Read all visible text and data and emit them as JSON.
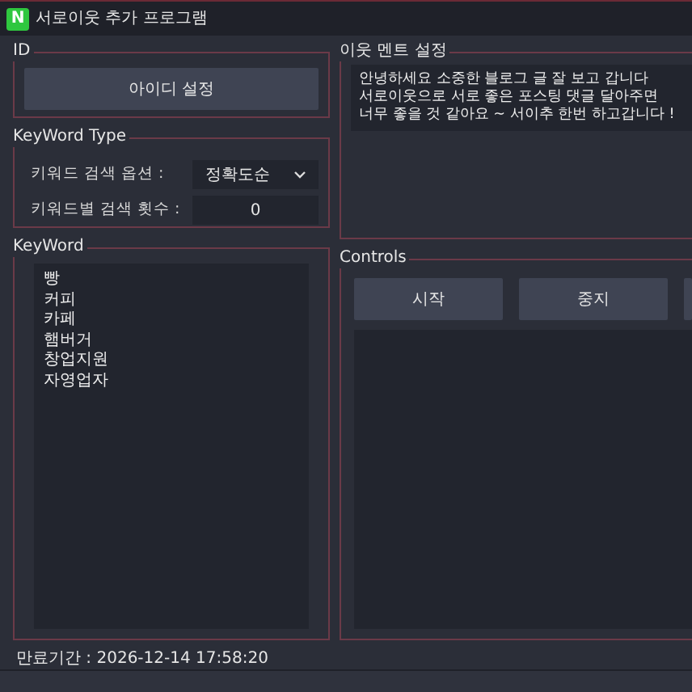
{
  "window": {
    "logo": "N",
    "title": "서로이웃 추가 프로그램"
  },
  "id_group": {
    "title": "ID",
    "button": "아이디 설정"
  },
  "keyword_type": {
    "title": "KeyWord Type",
    "fields": [
      {
        "kind": "select",
        "label": "키워드 검색 옵션 :",
        "value": "정확도순"
      },
      {
        "kind": "number",
        "label": "키워드별 검색 횟수 :",
        "value": "0"
      }
    ]
  },
  "comment": {
    "title": "이웃 멘트 설정",
    "lines": [
      "안녕하세요 소중한 블로그 글 잘 보고 갑니다",
      "서로이웃으로 서로 좋은 포스팅 댓글 달아주면",
      "너무 좋을 것 같아요 ~ 서이추 한번 하고갑니다 !"
    ]
  },
  "keywords": {
    "title": "KeyWord",
    "items": [
      "빵",
      "커피",
      "카페",
      "햄버거",
      "창업지원",
      "자영업자"
    ]
  },
  "controls": {
    "title": "Controls",
    "buttons": [
      "시작",
      "중지"
    ]
  },
  "status_bar": {
    "text": "만료기간 : 2026-12-14 17:58:20"
  }
}
